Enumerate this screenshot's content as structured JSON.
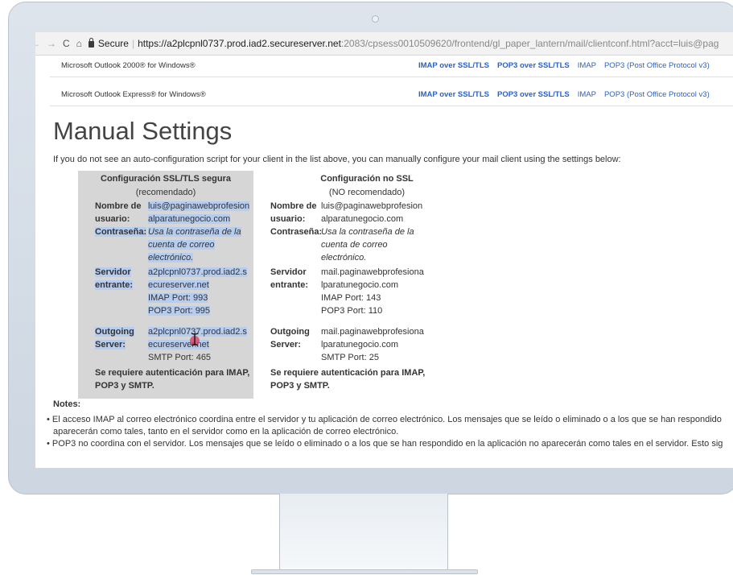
{
  "browser": {
    "back_icon": "←",
    "forward_icon": "→",
    "reload_icon": "C",
    "home_icon": "⌂",
    "secure_label": "Secure",
    "url_host": "https://a2plcpnl0737.prod.iad2.secureserver.net",
    "url_rest": ":2083/cpsess0010509620/frontend/gl_paper_lantern/mail/clientconf.html?acct=luis@pag"
  },
  "clients": [
    {
      "name": "Microsoft Outlook 2000® for Windows®",
      "imap_ssl": "IMAP over SSL/TLS",
      "pop3_ssl": "POP3 over SSL/TLS",
      "imap": "IMAP",
      "pop3": "POP3 (Post Office Protocol v3)"
    },
    {
      "name": "Microsoft Outlook Express® for Windows®",
      "imap_ssl": "IMAP over SSL/TLS",
      "pop3_ssl": "POP3 over SSL/TLS",
      "imap": "IMAP",
      "pop3": "POP3 (Post Office Protocol v3)"
    }
  ],
  "manual": {
    "heading": "Manual Settings",
    "intro": "If you do not see an auto-configuration script for your client in the list above, you can manually configure your mail client using the settings below:"
  },
  "ssl": {
    "title": "Configuración SSL/TLS segura",
    "subtitle": "(recomendado)",
    "user_label_1": "Nombre de",
    "user_label_2": "usuario:",
    "user_value_1": "luis@paginawebprofesion",
    "user_value_2": "alparatunegocio.com",
    "pass_label": "Contraseña:",
    "pass_value_1": "Usa la contraseña de la",
    "pass_value_2": "cuenta de correo",
    "pass_value_3": "electrónico.",
    "in_label_1": "Servidor",
    "in_label_2": "entrante:",
    "in_value_1": "a2plcpnl0737.prod.iad2.s",
    "in_value_2": "ecureserver.net",
    "in_imap": "IMAP Port: 993",
    "in_pop": "POP3 Port: 995",
    "out_label_1": "Outgoing",
    "out_label_2": "Server:",
    "out_value_1": "a2plcpnl0737.prod.iad2.s",
    "out_value_2": "ecureserver.net",
    "out_smtp": "SMTP Port: 465",
    "auth_1": "Se requiere autenticación para IMAP,",
    "auth_2": "POP3 y SMTP."
  },
  "nonssl": {
    "title": "Configuración no SSL",
    "subtitle": "(NO recomendado)",
    "user_label_1": "Nombre de",
    "user_label_2": "usuario:",
    "user_value_1": "luis@paginawebprofesion",
    "user_value_2": "alparatunegocio.com",
    "pass_label": "Contraseña:",
    "pass_value_1": "Usa la contraseña de la",
    "pass_value_2": "cuenta de correo",
    "pass_value_3": "electrónico.",
    "in_label_1": "Servidor",
    "in_label_2": "entrante:",
    "in_value_1": "mail.paginawebprofesiona",
    "in_value_2": "lparatunegocio.com",
    "in_imap": "IMAP Port: 143",
    "in_pop": "POP3 Port: 110",
    "out_label_1": "Outgoing",
    "out_label_2": "Server:",
    "out_value_1": "mail.paginawebprofesiona",
    "out_value_2": "lparatunegocio.com",
    "out_smtp": "SMTP Port: 25",
    "auth_1": "Se requiere autenticación para IMAP,",
    "auth_2": "POP3 y SMTP."
  },
  "notes": {
    "title": "Notes:",
    "n1_a": "El acceso IMAP al correo electrónico coordina entre el servidor y tu aplicación de correo electrónico. Los mensajes que se leído o eliminado o a los que se han respondido",
    "n1_b": "aparecerán como tales, tanto en el servidor como en la aplicación de correo electrónico.",
    "n2_a": "POP3 no coordina con el servidor. Los mensajes que se leído o eliminado o a los que se han respondido en la aplicación no aparecerán como tales en el servidor. Esto sig"
  },
  "colors": {
    "link": "#2a62c8",
    "highlight": "#b7cdf0",
    "ssl_box": "#d6d6d6",
    "monitor": "#cdd6e1"
  }
}
